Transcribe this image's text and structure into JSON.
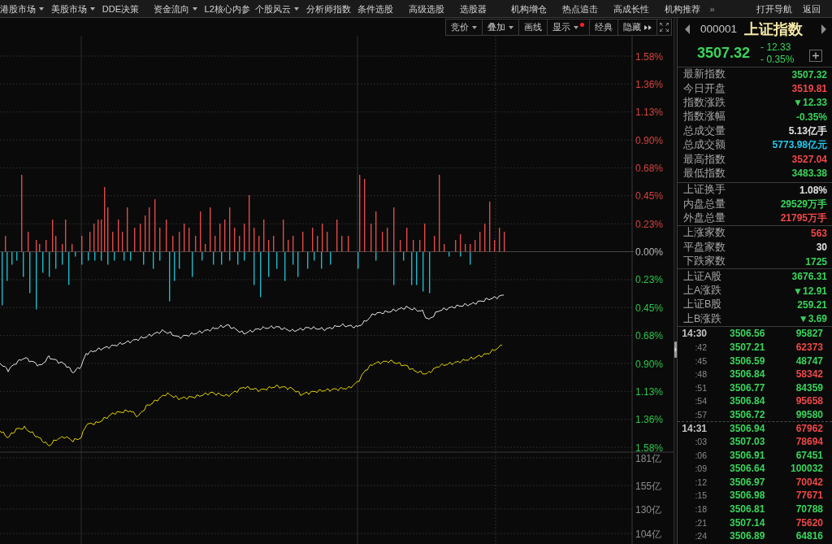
{
  "menu_bar": {
    "items": [
      {
        "label": "港股市场",
        "kind": "dropdown"
      },
      {
        "label": "美股市场",
        "kind": "dropdown"
      },
      {
        "label": "DDE决策",
        "kind": "plain"
      },
      {
        "label": "资金流向",
        "kind": "dropdown"
      },
      {
        "label": "L2核心内参",
        "kind": "plain"
      },
      {
        "label": "个股风云",
        "kind": "dropdown"
      },
      {
        "label": "分析师指数",
        "kind": "plain"
      },
      {
        "label": "条件选股",
        "kind": "plain"
      },
      {
        "label": "高级选股",
        "kind": "plain"
      },
      {
        "label": "选股器",
        "kind": "plain"
      },
      {
        "label": "机构增仓",
        "kind": "plain"
      },
      {
        "label": "热点追击",
        "kind": "plain"
      },
      {
        "label": "高成长性",
        "kind": "plain"
      },
      {
        "label": "机构推荐",
        "kind": "plain"
      }
    ],
    "more": "»",
    "right_items": [
      "打开导航",
      "返回"
    ]
  },
  "toolbar": {
    "buttons": [
      {
        "label": "竞价",
        "kind": "dropdown",
        "alert": false
      },
      {
        "label": "叠加",
        "kind": "dropdown",
        "alert": false
      },
      {
        "label": "画线",
        "kind": "plain",
        "alert": false
      },
      {
        "label": "显示",
        "kind": "dropdown",
        "alert": true
      },
      {
        "label": "经典",
        "kind": "plain",
        "alert": false
      },
      {
        "label": "隐藏",
        "kind": "expand",
        "alert": false
      }
    ]
  },
  "chart": {
    "percent_axis": [
      {
        "label": "1.58%",
        "color": "#d2453d"
      },
      {
        "label": "1.36%",
        "color": "#d2453d"
      },
      {
        "label": "1.13%",
        "color": "#d2453d"
      },
      {
        "label": "0.90%",
        "color": "#d2453d"
      },
      {
        "label": "0.68%",
        "color": "#d2453d"
      },
      {
        "label": "0.45%",
        "color": "#d2453d"
      },
      {
        "label": "0.23%",
        "color": "#d2453d"
      },
      {
        "label": "0.00%",
        "color": "#b8b8b8"
      },
      {
        "label": "0.23%",
        "color": "#30c44c"
      },
      {
        "label": "0.45%",
        "color": "#30c44c"
      },
      {
        "label": "0.68%",
        "color": "#30c44c"
      },
      {
        "label": "0.90%",
        "color": "#30c44c"
      },
      {
        "label": "1.13%",
        "color": "#30c44c"
      },
      {
        "label": "1.36%",
        "color": "#30c44c"
      },
      {
        "label": "1.58%",
        "color": "#30c44c"
      }
    ],
    "volume_axis": [
      "181亿",
      "155亿",
      "130亿",
      "104亿"
    ]
  },
  "quote_panel": {
    "code": "000001",
    "name": "上证指数",
    "price": "3507.32",
    "change": "- 12.33",
    "change_percent": "- 0.35%",
    "sections": [
      {
        "rows": [
          {
            "label": "最新指数",
            "value": "3507.32",
            "color": "#3ad45c"
          },
          {
            "label": "今日开盘",
            "value": "3519.81",
            "color": "#f04848"
          },
          {
            "label": "指数涨跌",
            "value": "▼12.33",
            "color": "#3ad45c"
          },
          {
            "label": "指数涨幅",
            "value": "-0.35%",
            "color": "#3ad45c"
          },
          {
            "label": "总成交量",
            "value": "5.13亿手",
            "color": "#e2e2e2"
          },
          {
            "label": "总成交额",
            "value": "5773.98亿元",
            "color": "#22c8ee"
          },
          {
            "label": "最高指数",
            "value": "3527.04",
            "color": "#f04848"
          },
          {
            "label": "最低指数",
            "value": "3483.38",
            "color": "#3ad45c"
          }
        ]
      },
      {
        "rows": [
          {
            "label": "上证换手",
            "value": "1.08%",
            "color": "#e2e2e2"
          },
          {
            "label": "内盘总量",
            "value": "29529万手",
            "color": "#3ad45c"
          },
          {
            "label": "外盘总量",
            "value": "21795万手",
            "color": "#f04848"
          }
        ]
      },
      {
        "rows": [
          {
            "label": "上涨家数",
            "value": "563",
            "color": "#f04848"
          },
          {
            "label": "平盘家数",
            "value": "30",
            "color": "#e2e2e2"
          },
          {
            "label": "下跌家数",
            "value": "1725",
            "color": "#3ad45c"
          }
        ]
      },
      {
        "rows": [
          {
            "label": "上证A股",
            "value": "3676.31",
            "color": "#3ad45c"
          },
          {
            "label": "上A涨跌",
            "value": "▼12.91",
            "color": "#3ad45c"
          },
          {
            "label": "上证B股",
            "value": "259.21",
            "color": "#3ad45c"
          },
          {
            "label": "上B涨跌",
            "value": "▼3.69",
            "color": "#3ad45c"
          }
        ]
      }
    ]
  },
  "trades": [
    {
      "time": "14:30",
      "kind": "minute",
      "price": "3506.56",
      "volume": "95827",
      "color": "#3ad45c"
    },
    {
      "time": ":42",
      "kind": "second",
      "price": "3507.21",
      "volume": "62373",
      "color": "#f04848"
    },
    {
      "time": ":45",
      "kind": "second",
      "price": "3506.59",
      "volume": "48747",
      "color": "#3ad45c"
    },
    {
      "time": ":48",
      "kind": "second",
      "price": "3506.84",
      "volume": "58342",
      "color": "#f04848"
    },
    {
      "time": ":51",
      "kind": "second",
      "price": "3506.77",
      "volume": "84359",
      "color": "#3ad45c"
    },
    {
      "time": ":54",
      "kind": "second",
      "price": "3506.84",
      "volume": "95658",
      "color": "#f04848"
    },
    {
      "time": ":57",
      "kind": "second",
      "price": "3506.72",
      "volume": "99580",
      "color": "#3ad45c"
    },
    {
      "time": "14:31",
      "kind": "minute",
      "price": "3506.94",
      "volume": "67962",
      "color": "#f04848"
    },
    {
      "time": ":03",
      "kind": "second",
      "price": "3507.03",
      "volume": "78694",
      "color": "#f04848"
    },
    {
      "time": ":06",
      "kind": "second",
      "price": "3506.91",
      "volume": "67451",
      "color": "#3ad45c"
    },
    {
      "time": ":09",
      "kind": "second",
      "price": "3506.64",
      "volume": "100032",
      "color": "#3ad45c"
    },
    {
      "time": ":12",
      "kind": "second",
      "price": "3506.97",
      "volume": "70042",
      "color": "#f04848"
    },
    {
      "time": ":15",
      "kind": "second",
      "price": "3506.98",
      "volume": "77671",
      "color": "#f04848"
    },
    {
      "time": ":18",
      "kind": "second",
      "price": "3506.81",
      "volume": "70788",
      "color": "#3ad45c"
    },
    {
      "time": ":21",
      "kind": "second",
      "price": "3507.14",
      "volume": "75620",
      "color": "#f04848"
    },
    {
      "time": ":24",
      "kind": "second",
      "price": "3506.89",
      "volume": "64816",
      "color": "#3ad45c"
    }
  ]
}
